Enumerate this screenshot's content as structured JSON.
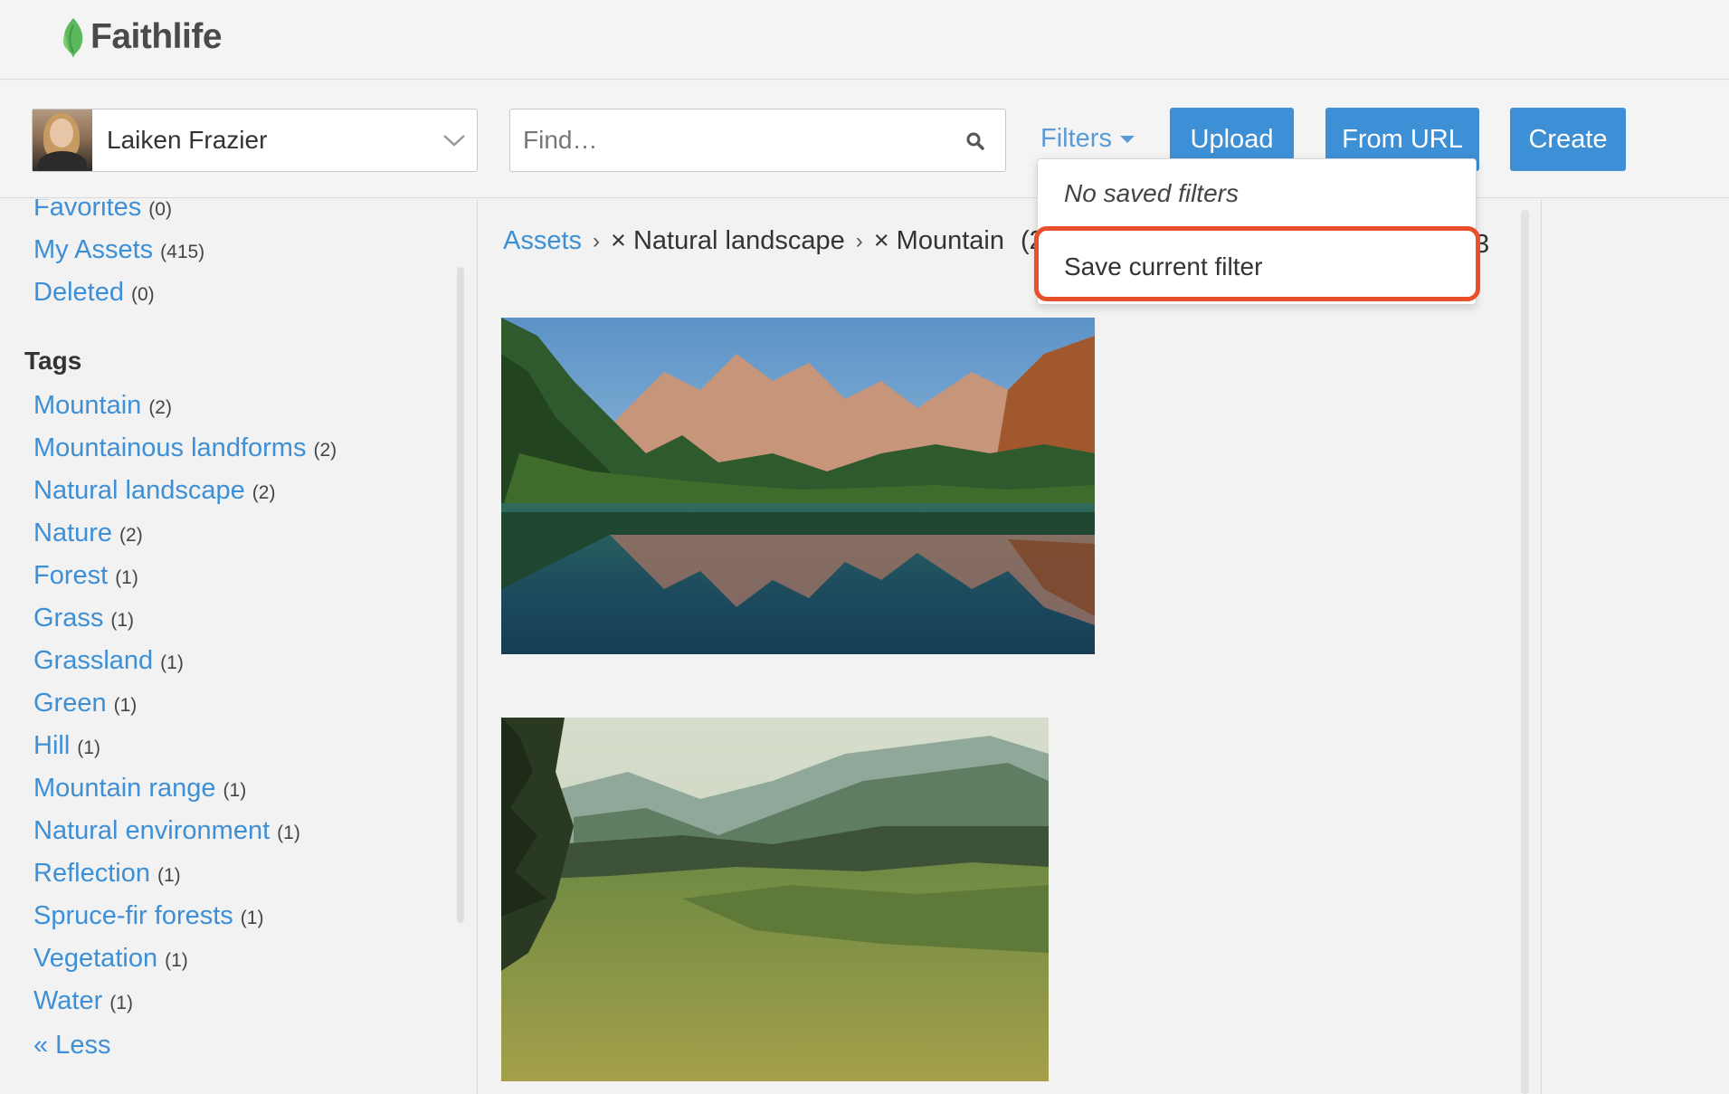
{
  "app": {
    "name": "Faithlife"
  },
  "account": {
    "name": "Laiken Frazier"
  },
  "search": {
    "placeholder": "Find…"
  },
  "toolbar": {
    "filters_label": "Filters",
    "upload_label": "Upload",
    "from_url_label": "From URL",
    "create_label": "Create"
  },
  "sidebar": {
    "top_items": [
      {
        "label": "Favorites",
        "count": "(0)"
      },
      {
        "label": "My Assets",
        "count": "(415)"
      },
      {
        "label": "Deleted",
        "count": "(0)"
      }
    ],
    "tags_heading": "Tags",
    "tags": [
      {
        "label": "Mountain",
        "count": "(2)"
      },
      {
        "label": "Mountainous landforms",
        "count": "(2)"
      },
      {
        "label": "Natural landscape",
        "count": "(2)"
      },
      {
        "label": "Nature",
        "count": "(2)"
      },
      {
        "label": "Forest",
        "count": "(1)"
      },
      {
        "label": "Grass",
        "count": "(1)"
      },
      {
        "label": "Grassland",
        "count": "(1)"
      },
      {
        "label": "Green",
        "count": "(1)"
      },
      {
        "label": "Hill",
        "count": "(1)"
      },
      {
        "label": "Mountain range",
        "count": "(1)"
      },
      {
        "label": "Natural environment",
        "count": "(1)"
      },
      {
        "label": "Reflection",
        "count": "(1)"
      },
      {
        "label": "Spruce-fir forests",
        "count": "(1)"
      },
      {
        "label": "Vegetation",
        "count": "(1)"
      },
      {
        "label": "Water",
        "count": "(1)"
      }
    ],
    "less_label": "« Less"
  },
  "breadcrumb": {
    "root": "Assets",
    "sep": "›",
    "remove": "×",
    "filters": [
      "Natural landscape",
      "Mountain"
    ],
    "count_partial": "(2",
    "trailing": "3"
  },
  "filters_menu": {
    "empty_label": "No saved filters",
    "save_label": "Save current filter"
  },
  "colors": {
    "link": "#3d8fd6",
    "button": "#3d8fd6",
    "highlight": "#e8502c",
    "logo_leaf": "#5cb85c"
  }
}
